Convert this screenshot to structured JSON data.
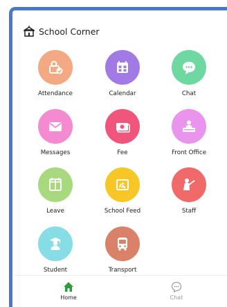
{
  "header": {
    "title": "School Corner",
    "icon": "school-building-icon"
  },
  "tiles": [
    {
      "label": "Attendance",
      "icon": "attendance-icon",
      "color": "#f3a981"
    },
    {
      "label": "Calendar",
      "icon": "calendar-icon",
      "color": "#a27ae6"
    },
    {
      "label": "Chat",
      "icon": "chat-bubble-icon",
      "color": "#6ed7a2"
    },
    {
      "label": "Messages",
      "icon": "envelope-icon",
      "color": "#f48ad0"
    },
    {
      "label": "Fee",
      "icon": "money-icon",
      "color": "#f0567c"
    },
    {
      "label": "Front Office",
      "icon": "desk-icon",
      "color": "#ea95ed"
    },
    {
      "label": "Leave",
      "icon": "leave-icon",
      "color": "#a9d97e"
    },
    {
      "label": "School Feed",
      "icon": "feed-icon",
      "color": "#f6c727"
    },
    {
      "label": "Staff",
      "icon": "teacher-icon",
      "color": "#f06a69"
    },
    {
      "label": "Student",
      "icon": "graduate-icon",
      "color": "#86dde5"
    },
    {
      "label": "Transport",
      "icon": "bus-icon",
      "color": "#d98269"
    }
  ],
  "bottom_nav": {
    "home": {
      "label": "Home",
      "icon": "home-icon",
      "color": "#2e9b3f",
      "active": true
    },
    "chat": {
      "label": "Chat",
      "icon": "chat-bubble-outline-icon",
      "color": "#9a9a9a",
      "active": false
    }
  }
}
